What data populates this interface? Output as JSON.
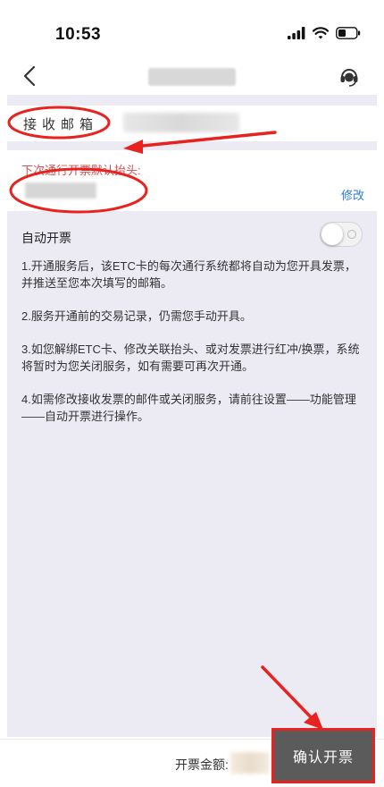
{
  "status": {
    "time": "10:53"
  },
  "nav": {
    "back_icon": "chevron-left-icon",
    "support_icon": "headset-icon"
  },
  "email": {
    "label": "接收邮箱"
  },
  "header": {
    "hint": "下次通行开票默认抬头:",
    "edit_label": "修改"
  },
  "auto_invoice": {
    "title": "自动开票",
    "enabled": false,
    "notes": [
      "1.开通服务后，该ETC卡的每次通行系统都将自动为您开具发票，并推送至您本次填写的邮箱。",
      "2.服务开通前的交易记录，仍需您手动开具。",
      "3.如您解绑ETC卡、修改关联抬头、或对发票进行红冲/换票，系统将暂时为您关闭服务，如有需要可再次开通。",
      "4.如需修改接收发票的邮件或关闭服务，请前往设置——功能管理——自动开票进行操作。"
    ]
  },
  "footer": {
    "amount_label": "开票金额:",
    "confirm_label": "确认开票"
  },
  "colors": {
    "annotation_red": "#e8231f",
    "link_blue": "#2f7bd6",
    "hint_red": "#d45050",
    "panel_bg": "#eceaf3"
  }
}
